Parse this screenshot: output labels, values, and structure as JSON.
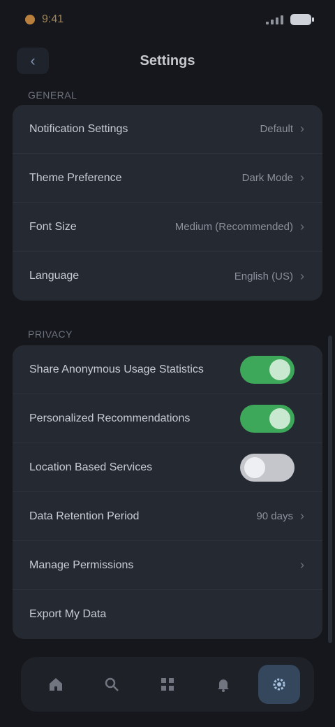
{
  "status_bar": {
    "time": "9:41",
    "icons": [
      "signal-icon",
      "battery-icon"
    ]
  },
  "header": {
    "title": "Settings",
    "back_icon": "back-arrow-icon"
  },
  "sections": [
    {
      "label": "GENERAL",
      "rows": [
        {
          "label": "Notification Settings",
          "value": "Default"
        },
        {
          "label": "Theme Preference",
          "value": "Dark Mode"
        },
        {
          "label": "Font Size",
          "value": "Medium (Recommended)"
        },
        {
          "label": "Language",
          "value": "English (US)"
        }
      ]
    },
    {
      "label": "PRIVACY",
      "rows": [
        {
          "label": "Share Anonymous Usage Statistics",
          "toggle": true
        },
        {
          "label": "Personalized Recommendations",
          "toggle": true
        },
        {
          "label": "Location Based Services",
          "toggle": false
        },
        {
          "label": "Data Retention Period",
          "value": "90 days"
        },
        {
          "label": "Manage Permissions"
        },
        {
          "label": "Export My Data"
        }
      ]
    }
  ],
  "bottom_nav": {
    "items": [
      {
        "icon": "home-icon",
        "name": "nav-home"
      },
      {
        "icon": "search-icon",
        "name": "nav-search"
      },
      {
        "icon": "grid-icon",
        "name": "nav-apps"
      },
      {
        "icon": "bell-icon",
        "name": "nav-notifications"
      },
      {
        "icon": "gear-icon",
        "name": "nav-settings",
        "active": true
      }
    ]
  },
  "colors": {
    "accent_green": "#3ea85a",
    "active_nav": "#34475c",
    "card": "#252932",
    "background": "#15171c"
  }
}
